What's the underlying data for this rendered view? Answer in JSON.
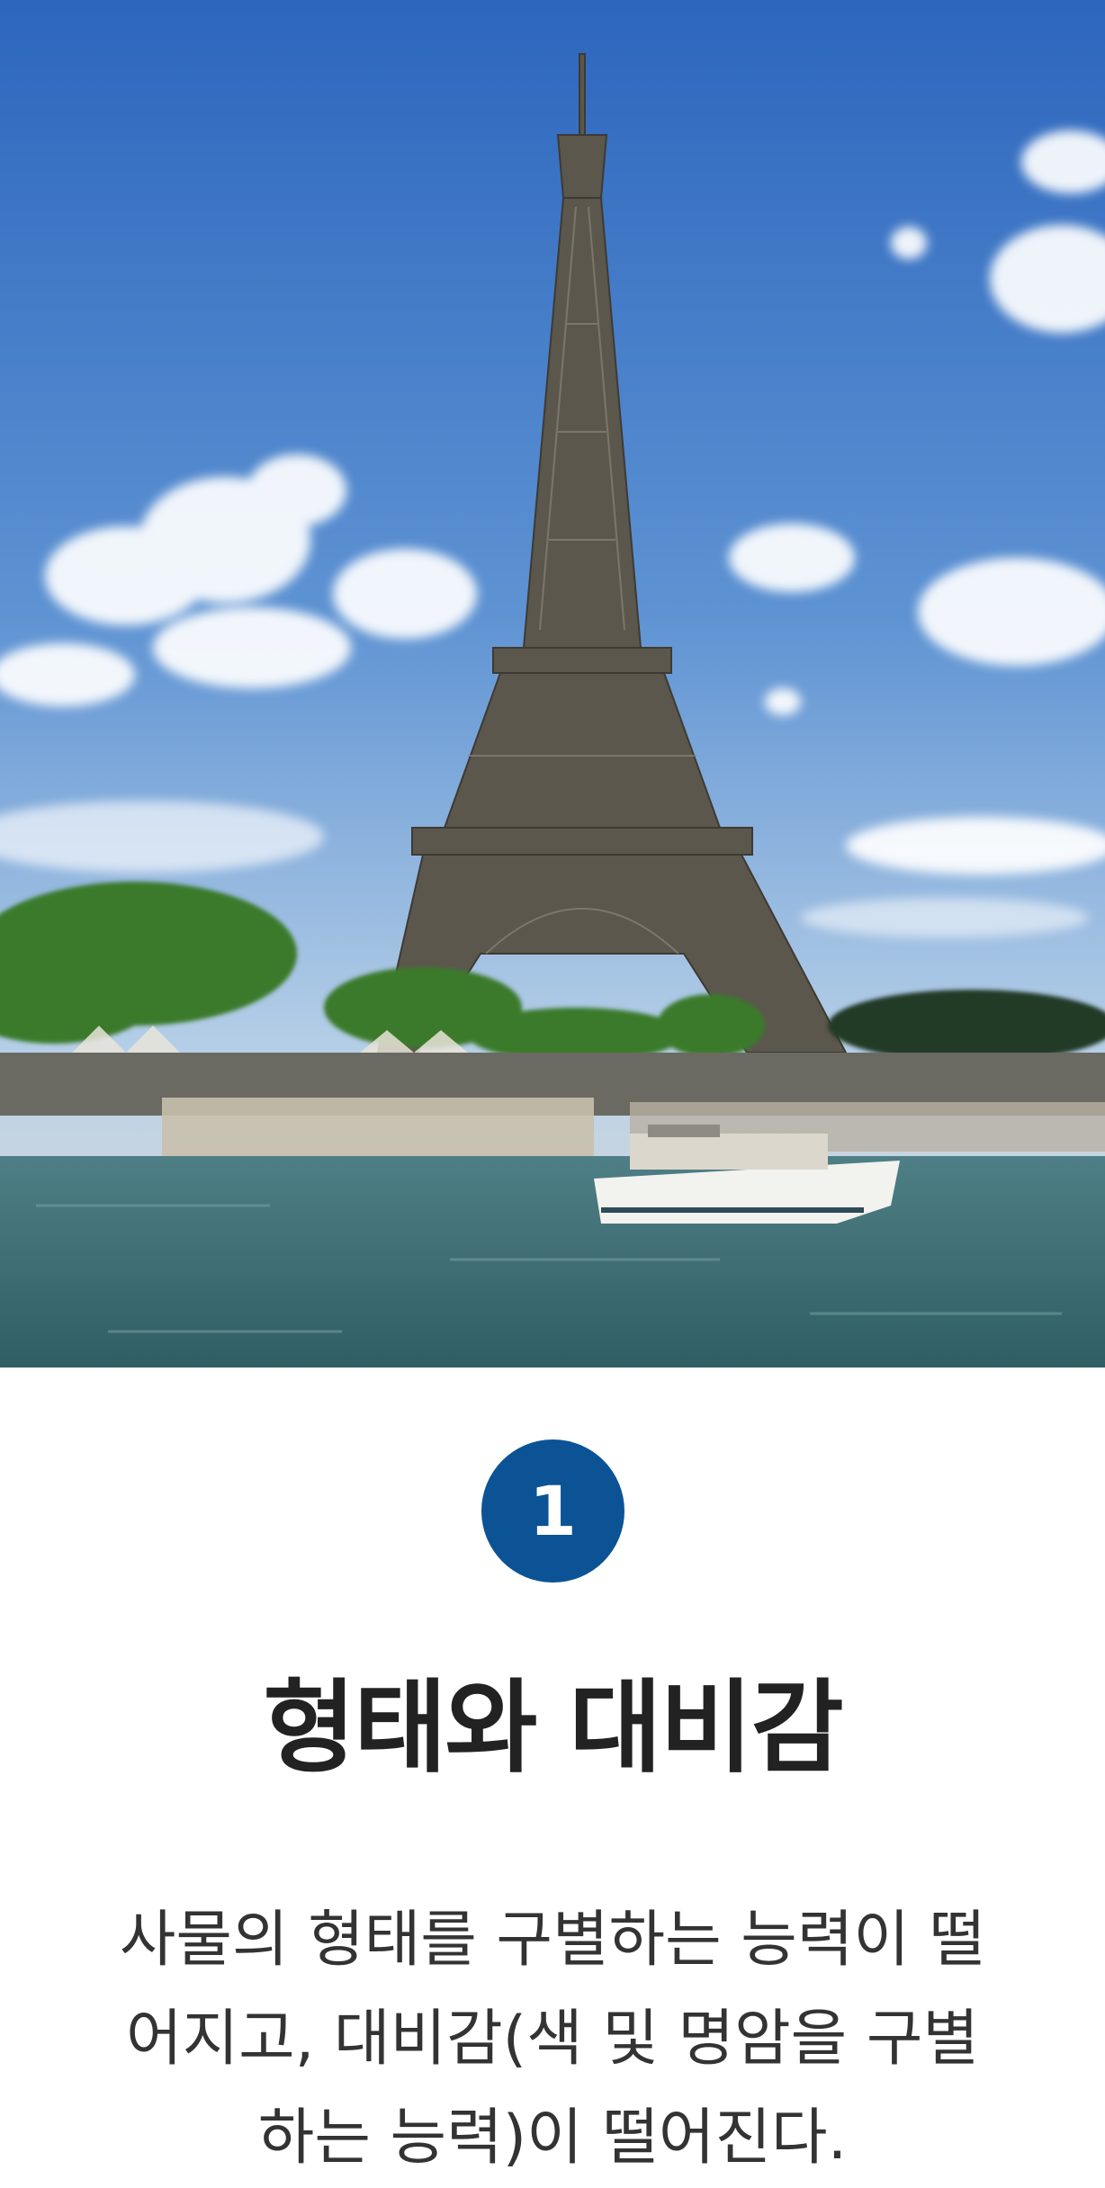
{
  "hero": {
    "image": "eiffel-tower-photo",
    "colors": {
      "sky_top": "#2f6fc4",
      "sky_bottom": "#d9e6f2",
      "river": "#3f6f73",
      "tower": "#5a554c",
      "trees": "#3d7a2e"
    }
  },
  "step": {
    "number": "1",
    "badge_color": "#0b5394"
  },
  "title": "형태와 대비감",
  "description": "사물의 형태를 구별하는 능력이 떨어지고, 대비감(색 및 명암을 구별하는 능력)이 떨어진다."
}
